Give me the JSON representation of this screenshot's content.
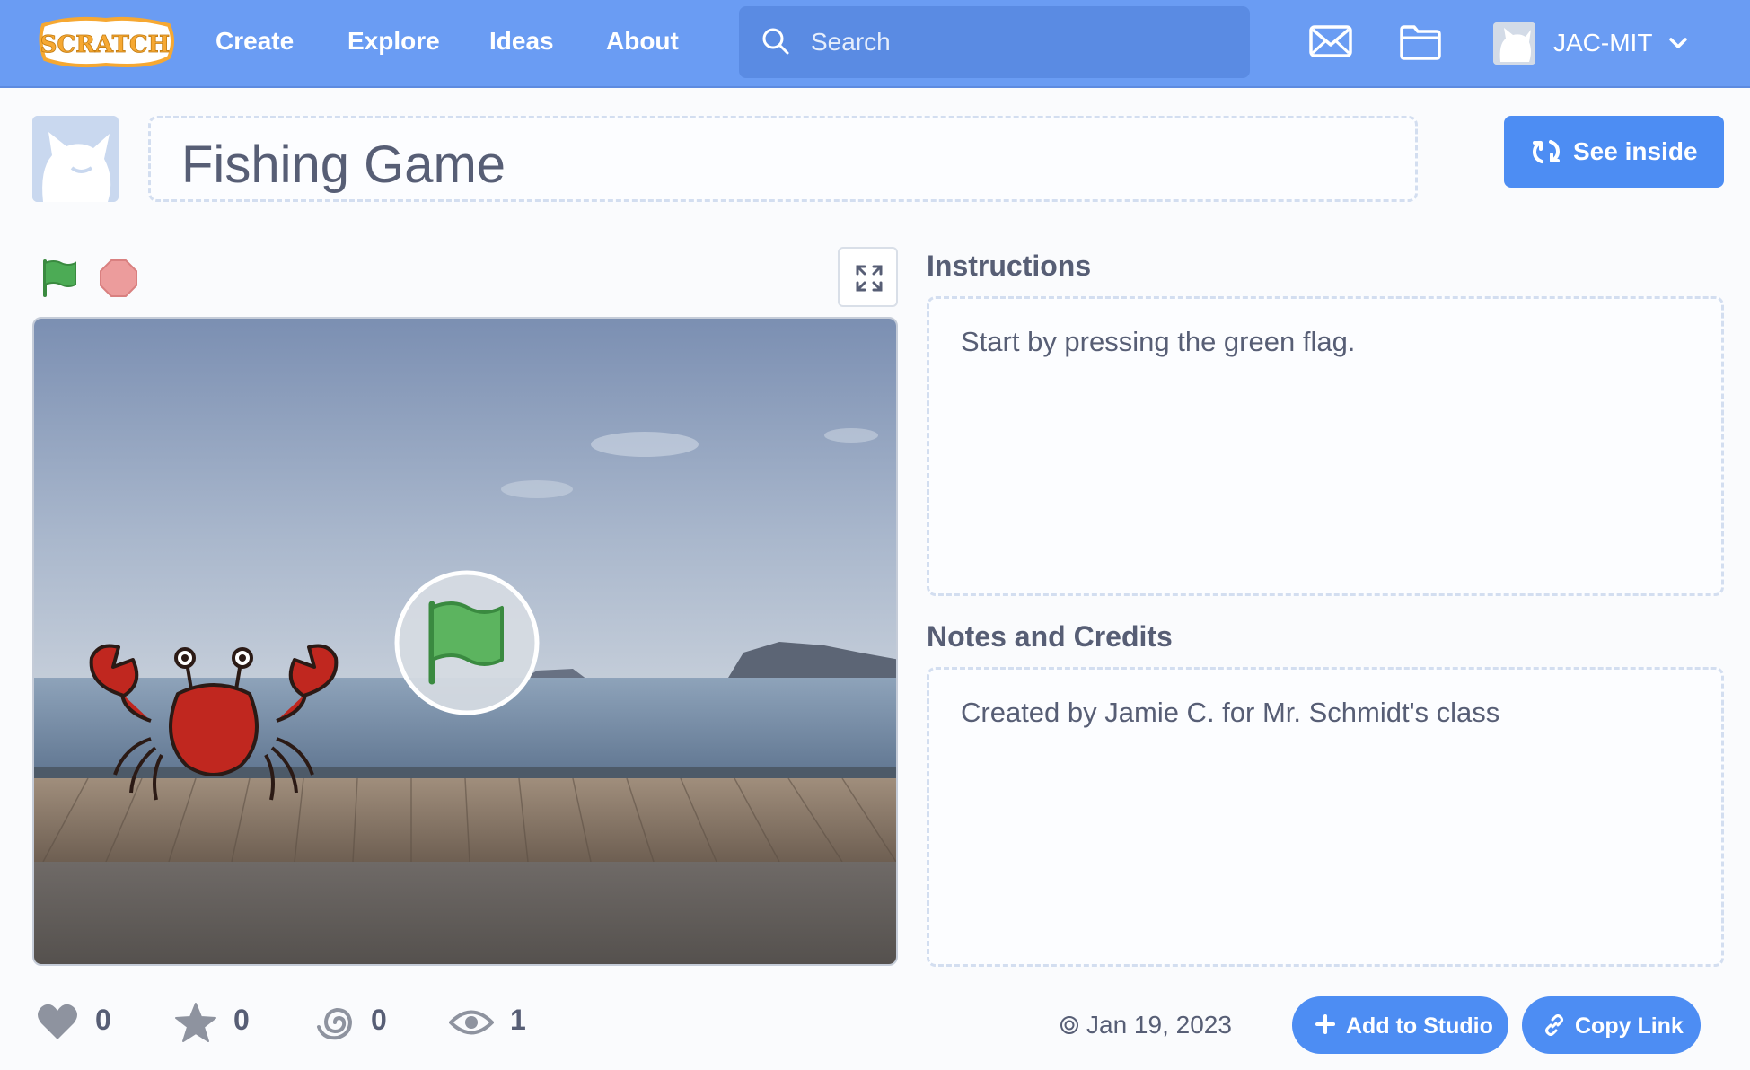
{
  "nav": {
    "logo_text": "SCRATCH",
    "links": [
      "Create",
      "Explore",
      "Ideas",
      "About"
    ],
    "search_placeholder": "Search",
    "username": "JAC-MIT"
  },
  "project": {
    "title": "Fishing Game",
    "see_inside_label": "See inside"
  },
  "instructions": {
    "heading": "Instructions",
    "text": "Start by pressing the green flag."
  },
  "notes": {
    "heading": "Notes and Credits",
    "text": "Created by Jamie C. for Mr. Schmidt's class"
  },
  "stats": {
    "loves": "0",
    "favorites": "0",
    "remixes": "0",
    "views": "1"
  },
  "date": "Jan 19, 2023",
  "actions": {
    "add_to_studio": "Add to Studio",
    "copy_link": "Copy Link"
  },
  "colors": {
    "topbar": "#6a9cf3",
    "accent": "#4d8df3",
    "text": "#575e75",
    "flag_green": "#4cab55",
    "stop_red": "#ec9c9c"
  }
}
